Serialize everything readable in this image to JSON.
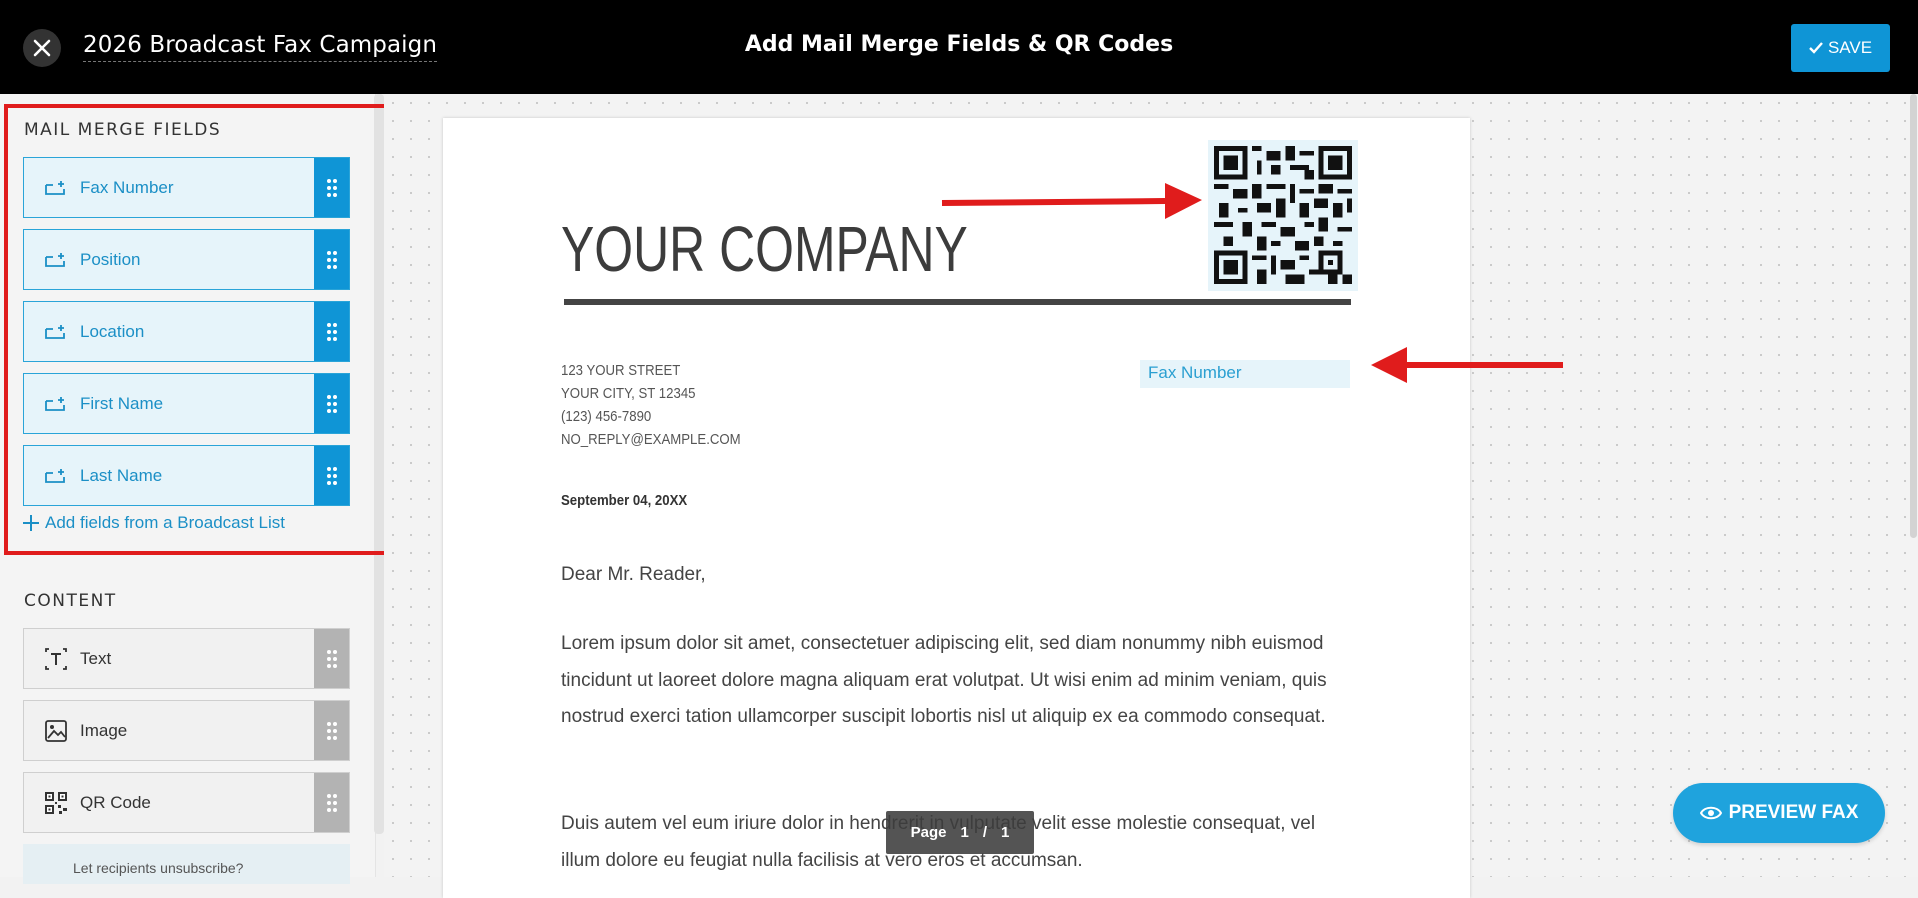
{
  "header": {
    "campaign_title": "2026 Broadcast Fax Campaign",
    "page_heading": "Add Mail Merge Fields & QR Codes",
    "save_label": "SAVE"
  },
  "sidebar": {
    "mail_merge_title": "MAIL MERGE FIELDS",
    "fields": [
      {
        "label": "Fax Number",
        "icon": "merge-field-icon"
      },
      {
        "label": "Position",
        "icon": "merge-field-icon"
      },
      {
        "label": "Location",
        "icon": "merge-field-icon"
      },
      {
        "label": "First Name",
        "icon": "merge-field-icon"
      },
      {
        "label": "Last Name",
        "icon": "merge-field-icon"
      }
    ],
    "add_fields_label": "Add fields from a Broadcast List",
    "content_title": "CONTENT",
    "content_items": [
      {
        "label": "Text",
        "icon": "text-icon"
      },
      {
        "label": "Image",
        "icon": "image-icon"
      },
      {
        "label": "QR Code",
        "icon": "qr-code-icon"
      }
    ],
    "unsubscribe_text": "Let recipients unsubscribe?"
  },
  "document": {
    "company": "YOUR COMPANY",
    "address": [
      "123 YOUR STREET",
      "YOUR CITY, ST 12345",
      "(123) 456-7890",
      "NO_REPLY@EXAMPLE.COM"
    ],
    "fax_field": "Fax Number",
    "date": "September 04, 20XX",
    "greeting": "Dear Mr. Reader,",
    "paragraph1": "Lorem ipsum dolor sit amet, consectetuer adipiscing elit, sed diam nonummy nibh euismod tincidunt ut laoreet dolore magna aliquam erat volutpat. Ut wisi enim ad minim veniam, quis nostrud exerci tation ullamcorper suscipit lobortis nisl ut aliquip ex ea commodo consequat.",
    "paragraph2": "Duis autem vel eum iriure dolor in hendrerit in vulputate velit esse molestie consequat, vel illum dolore eu feugiat nulla facilisis at vero eros et accumsan."
  },
  "pager": {
    "label": "Page",
    "current": "1",
    "separator": "/",
    "total": "1"
  },
  "preview_label": "PREVIEW FAX",
  "colors": {
    "accent": "#0f95d6",
    "annotation": "#e01c1c",
    "topbar": "#000000"
  }
}
